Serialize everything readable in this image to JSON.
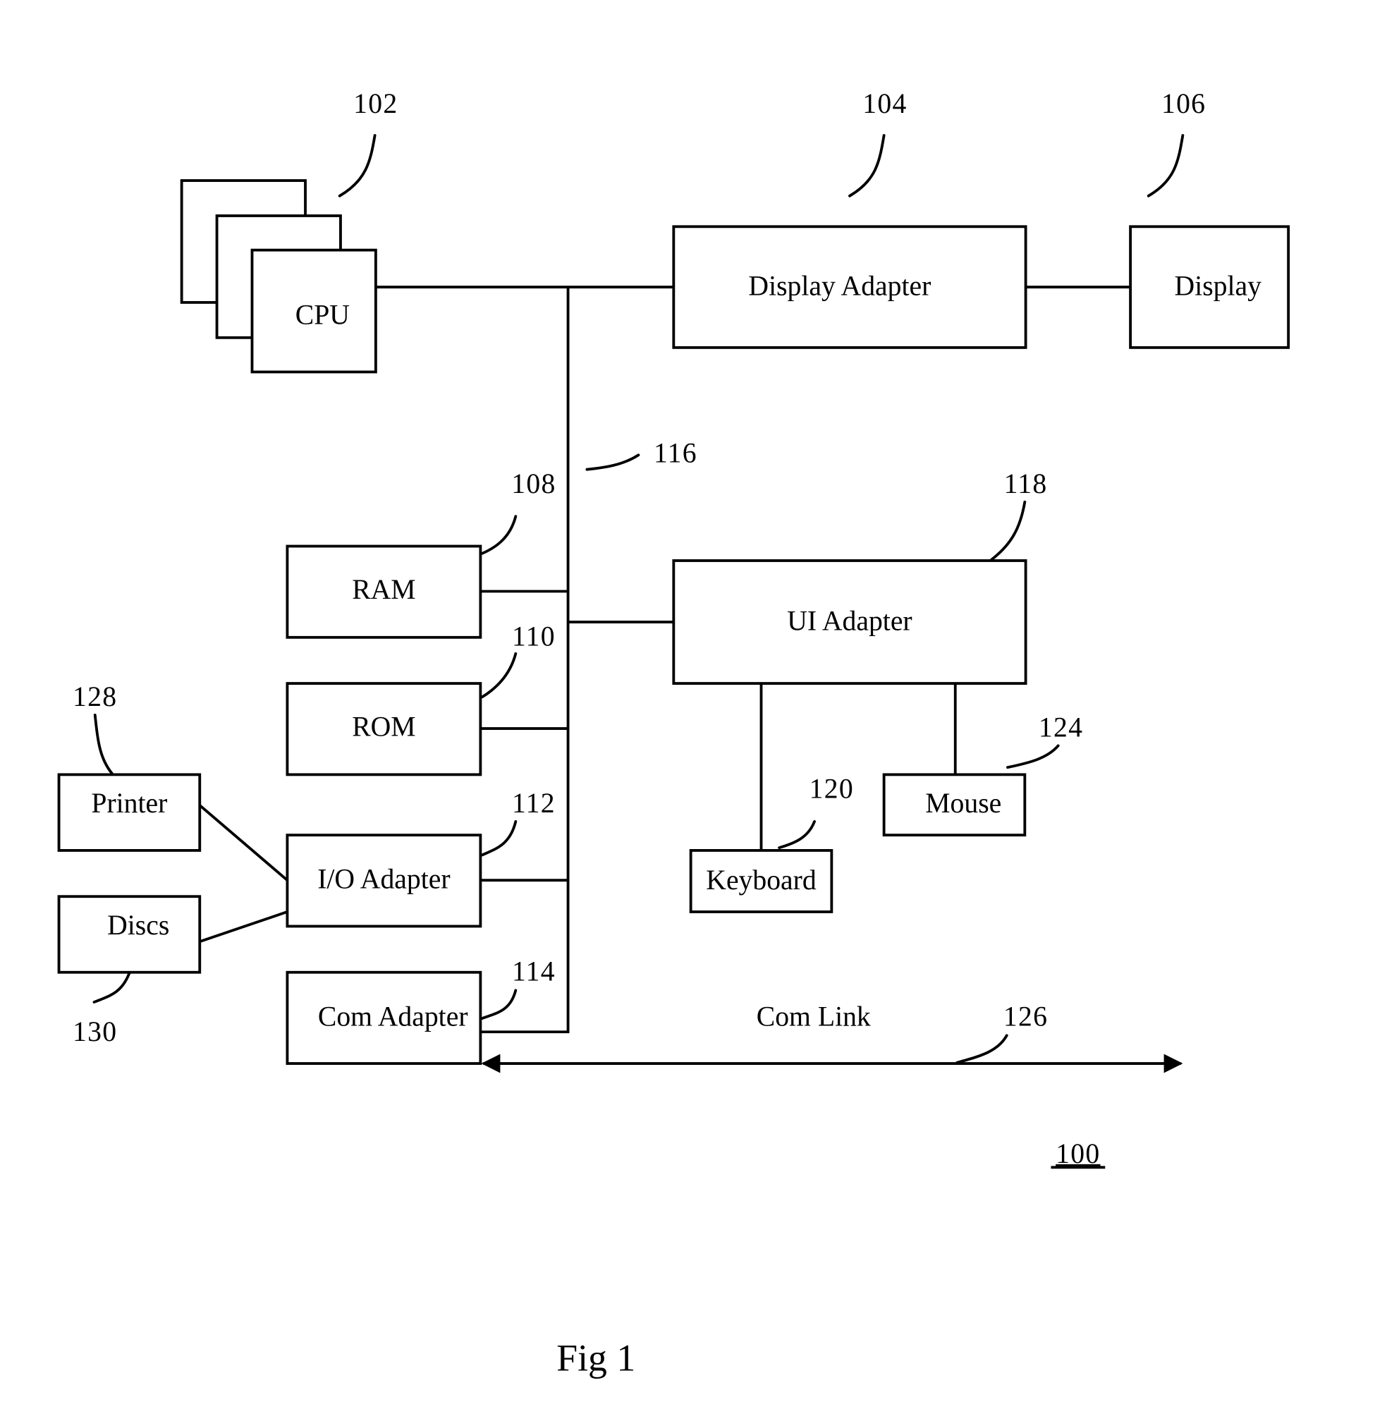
{
  "figure": {
    "caption": "Fig 1",
    "system_ref": "100"
  },
  "blocks": {
    "cpu": {
      "label": "CPU",
      "ref": "102"
    },
    "display_adapter": {
      "label": "Display Adapter",
      "ref": "104"
    },
    "display": {
      "label": "Display",
      "ref": "106"
    },
    "ram": {
      "label": "RAM",
      "ref": "108"
    },
    "rom": {
      "label": "ROM",
      "ref": "110"
    },
    "io_adapter": {
      "label": "I/O Adapter",
      "ref": "112"
    },
    "com_adapter": {
      "label": "Com Adapter",
      "ref": "114"
    },
    "bus": {
      "ref": "116"
    },
    "ui_adapter": {
      "label": "UI Adapter",
      "ref": "118"
    },
    "keyboard": {
      "label": "Keyboard",
      "ref": "120"
    },
    "mouse": {
      "label": "Mouse",
      "ref": "124"
    },
    "com_link": {
      "label": "Com Link",
      "ref": "126"
    },
    "printer": {
      "label": "Printer",
      "ref": "128"
    },
    "discs": {
      "label": "Discs",
      "ref": "130"
    }
  }
}
